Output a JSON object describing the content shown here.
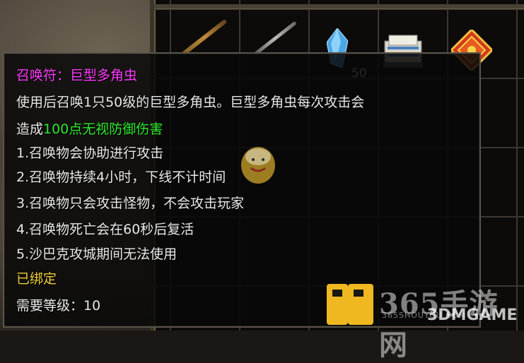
{
  "inventory": {
    "stack_count": "50"
  },
  "tooltip": {
    "title": "召唤符：巨型多角虫",
    "desc_line1": "使用后召唤1只50级的巨型多角虫。巨型多角虫每次攻击会",
    "desc_line2_prefix": "造成",
    "desc_line2_highlight": "100点无视防御伤害",
    "rules": [
      "1.召唤物会协助进行攻击",
      "2.召唤物持续4小时，下线不计时间",
      "3.召唤物只会攻击怪物，不会攻击玩家",
      "4.召唤物死亡会在60秒后复活",
      "5.沙巴克攻城期间无法使用"
    ],
    "bind_status": "已绑定",
    "level_req": "需要等级：10"
  },
  "watermark": {
    "site_name": "365手游网",
    "site_domain": "365SHOUYOU.COM",
    "brand": "3DMGAME"
  },
  "colors": {
    "title": "#ff3bff",
    "highlight": "#2dea2d",
    "bound": "#f3d13a",
    "text": "#e9e9e9"
  }
}
